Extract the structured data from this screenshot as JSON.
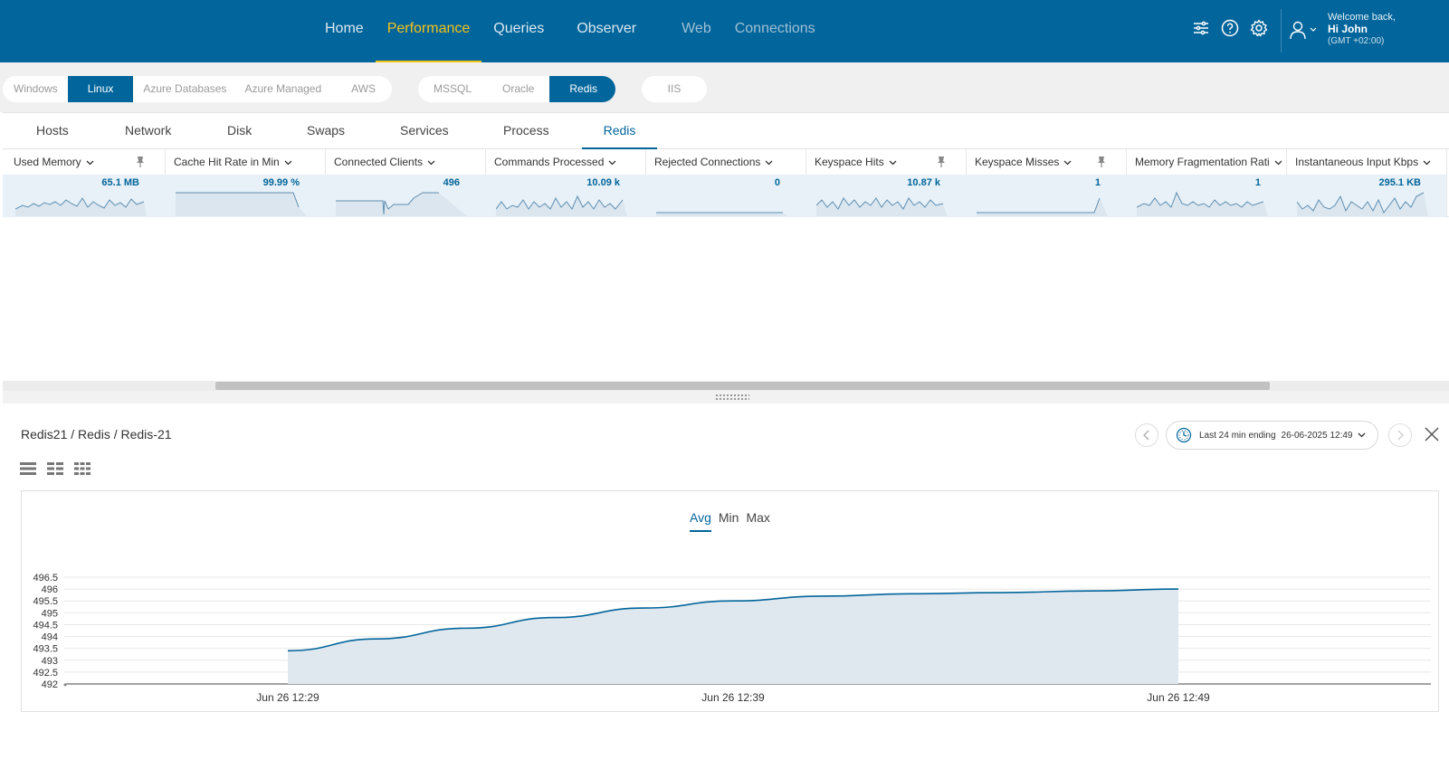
{
  "nav": {
    "items": [
      "Home",
      "Performance",
      "Queries",
      "Observer",
      "Web",
      "Connections"
    ],
    "active": "Performance"
  },
  "user": {
    "welcome": "Welcome back,",
    "name": "Hi John",
    "tz": "(GMT +02:00)"
  },
  "filters": {
    "os": [
      "Windows",
      "Linux",
      "Azure Databases",
      "Azure Managed",
      "AWS"
    ],
    "os_active": "Linux",
    "db": [
      "MSSQL",
      "Oracle",
      "Redis"
    ],
    "db_active": "Redis",
    "web": [
      "IIS"
    ]
  },
  "tabs": [
    "Hosts",
    "Network",
    "Disk",
    "Swaps",
    "Services",
    "Process",
    "Redis"
  ],
  "tab_active": "Redis",
  "metrics": [
    {
      "label": "Used Memory",
      "value": "65.1 MB",
      "pinned": true
    },
    {
      "label": "Cache Hit Rate in Min",
      "value": "99.99 %",
      "pinned": false
    },
    {
      "label": "Connected Clients",
      "value": "496",
      "pinned": false
    },
    {
      "label": "Commands Processed",
      "value": "10.09 k",
      "pinned": false
    },
    {
      "label": "Rejected Connections",
      "value": "0",
      "pinned": false
    },
    {
      "label": "Keyspace Hits",
      "value": "10.87 k",
      "pinned": true
    },
    {
      "label": "Keyspace Misses",
      "value": "1",
      "pinned": true
    },
    {
      "label": "Memory Fragmentation Rati",
      "value": "1",
      "pinned": false
    },
    {
      "label": "Instantaneous Input Kbps",
      "value": "295.1 KB",
      "pinned": false
    }
  ],
  "detail": {
    "breadcrumb": "Redis21 / Redis / Redis-21",
    "time_range": "Last 24 min ending",
    "time_end": "26-06-2025 12:49",
    "stat_tabs": [
      "Avg",
      "Min",
      "Max"
    ],
    "stat_active": "Avg"
  },
  "colors": {
    "brand": "#02659b",
    "nav_active": "#f4c319",
    "chart_fill": "#dfe7ef",
    "row_highlight": "#e8f1f7"
  },
  "chart_data": {
    "type": "area",
    "title": "",
    "xlabel": "",
    "ylabel": "",
    "ylim": [
      492,
      496.5
    ],
    "yticks": [
      "492",
      "492.5",
      "493",
      "493.5",
      "494",
      "494.5",
      "495",
      "495.5",
      "496",
      "496.5"
    ],
    "xticks": [
      "Jun 26 12:29",
      "Jun 26 12:39",
      "Jun 26 12:49"
    ],
    "series": [
      {
        "x": [
          "12:29",
          "12:31",
          "12:33",
          "12:35",
          "12:37",
          "12:39",
          "12:41",
          "12:43",
          "12:45",
          "12:47",
          "12:49"
        ],
        "values": [
          493.4,
          493.9,
          494.35,
          494.8,
          495.2,
          495.5,
          495.7,
          495.8,
          495.85,
          495.92,
          496.0
        ]
      }
    ],
    "grid": true
  }
}
